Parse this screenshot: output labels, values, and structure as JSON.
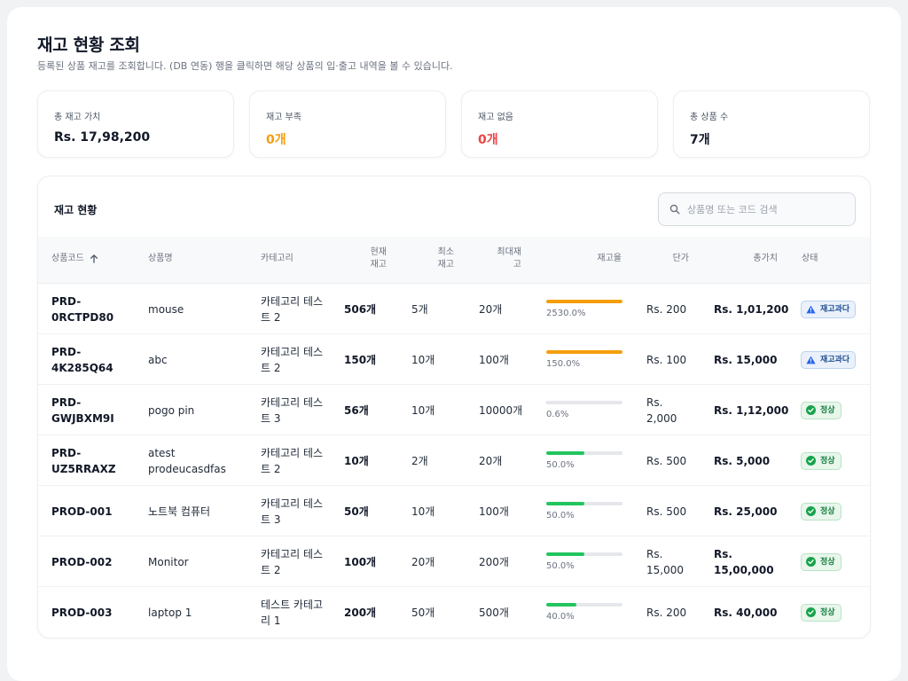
{
  "header": {
    "title": "재고 현황 조회",
    "subtitle": "등록된 상품 재고를 조회합니다. (DB 연동) 행을 클릭하면 해당 상품의 입·출고 내역을 볼 수 있습니다."
  },
  "summary": [
    {
      "label": "총 재고 가치",
      "value": "Rs. 17,98,200",
      "tone": "normal"
    },
    {
      "label": "재고 부족",
      "value": "0개",
      "tone": "warn"
    },
    {
      "label": "재고 없음",
      "value": "0개",
      "tone": "danger"
    },
    {
      "label": "총 상품 수",
      "value": "7개",
      "tone": "normal"
    }
  ],
  "panel": {
    "title": "재고 현황",
    "search_placeholder": "상품명 또는 코드 검색"
  },
  "columns": {
    "code": "상품코드",
    "name": "상품명",
    "category": "카테고리",
    "current": "현재\n재고",
    "min": "최소\n재고",
    "max": "최대재\n고",
    "rate": "재고율",
    "price": "단가",
    "total": "총가치",
    "status": "상태"
  },
  "colors": {
    "over": "#f59e0b",
    "normal": "#22c55e",
    "low": "#d1d5db"
  },
  "rows": [
    {
      "code": "PRD-\n0RCTPD80",
      "name": "mouse",
      "category": "카테고리 테스\n트 2",
      "current": "506개",
      "min": "5개",
      "max": "20개",
      "rate_label": "2530.0%",
      "rate_fill": 1.0,
      "bar_color": "#f59e0b",
      "price": "Rs. 200",
      "total": "Rs. 1,01,200",
      "status": "재고과다",
      "status_type": "over"
    },
    {
      "code": "PRD-\n4K285Q64",
      "name": "abc",
      "category": "카테고리 테스\n트 2",
      "current": "150개",
      "min": "10개",
      "max": "100개",
      "rate_label": "150.0%",
      "rate_fill": 1.0,
      "bar_color": "#f59e0b",
      "price": "Rs. 100",
      "total": "Rs. 15,000",
      "status": "재고과다",
      "status_type": "over"
    },
    {
      "code": "PRD-\nGWJBXM9I",
      "name": "pogo pin",
      "category": "카테고리 테스\n트 3",
      "current": "56개",
      "min": "10개",
      "max": "10000개",
      "rate_label": "0.6%",
      "rate_fill": 0.006,
      "bar_color": "#d1d5db",
      "price": "Rs.\n2,000",
      "total": "Rs. 1,12,000",
      "status": "정상",
      "status_type": "ok"
    },
    {
      "code": "PRD-\nUZ5RRAXZ",
      "name": "atest\nprodeucasdfas",
      "category": "카테고리 테스\n트 2",
      "current": "10개",
      "min": "2개",
      "max": "20개",
      "rate_label": "50.0%",
      "rate_fill": 0.5,
      "bar_color": "#22c55e",
      "price": "Rs. 500",
      "total": "Rs. 5,000",
      "status": "정상",
      "status_type": "ok"
    },
    {
      "code": "PROD-001",
      "name": "노트북 컴퓨터",
      "category": "카테고리 테스\n트 3",
      "current": "50개",
      "min": "10개",
      "max": "100개",
      "rate_label": "50.0%",
      "rate_fill": 0.5,
      "bar_color": "#22c55e",
      "price": "Rs. 500",
      "total": "Rs. 25,000",
      "status": "정상",
      "status_type": "ok"
    },
    {
      "code": "PROD-002",
      "name": "Monitor",
      "category": "카테고리 테스\n트 2",
      "current": "100개",
      "min": "20개",
      "max": "200개",
      "rate_label": "50.0%",
      "rate_fill": 0.5,
      "bar_color": "#22c55e",
      "price": "Rs.\n15,000",
      "total": "Rs.\n15,00,000",
      "status": "정상",
      "status_type": "ok"
    },
    {
      "code": "PROD-003",
      "name": "laptop 1",
      "category": "테스트 카테고\n리 1",
      "current": "200개",
      "min": "50개",
      "max": "500개",
      "rate_label": "40.0%",
      "rate_fill": 0.4,
      "bar_color": "#22c55e",
      "price": "Rs. 200",
      "total": "Rs. 40,000",
      "status": "정상",
      "status_type": "ok"
    }
  ]
}
